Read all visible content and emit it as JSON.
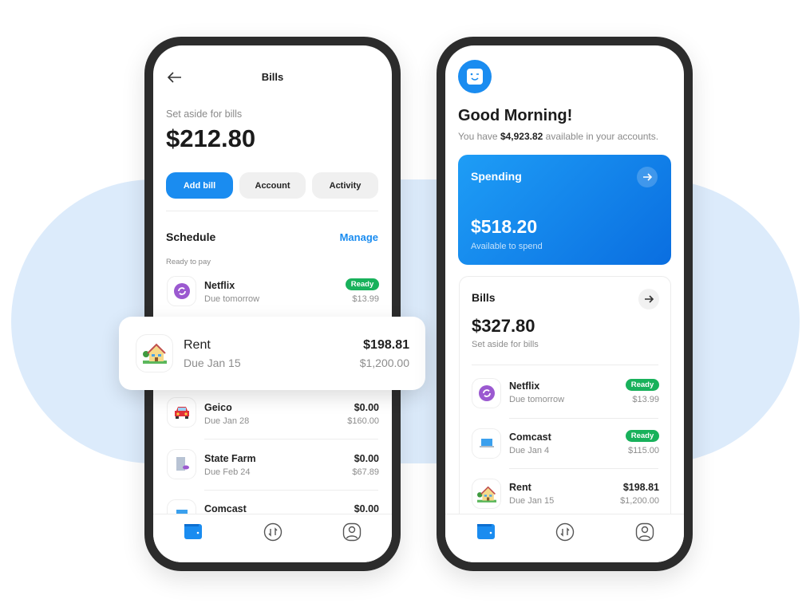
{
  "colors": {
    "accent": "#1a8cf0",
    "ready": "#18b15b",
    "background_blob": "#dcebfb"
  },
  "left_phone": {
    "header": {
      "back_icon": "arrow-left-icon",
      "title": "Bills"
    },
    "summary": {
      "label": "Set aside for bills",
      "amount": "$212.80"
    },
    "buttons": {
      "add_bill": "Add bill",
      "account": "Account",
      "activity": "Activity"
    },
    "schedule": {
      "title": "Schedule",
      "manage": "Manage",
      "section_label": "Ready to pay"
    },
    "bills": [
      {
        "name": "Netflix",
        "due": "Due tomorrow",
        "badge": "Ready",
        "amount": "$13.99",
        "icon": "refresh-icon"
      },
      {
        "name": "Rent",
        "due": "Due Jan 15",
        "amount": "$198.81",
        "total": "$1,200.00",
        "icon": "house-icon"
      },
      {
        "name": "Geico",
        "due": "Due Jan 28",
        "amount": "$0.00",
        "total": "$160.00",
        "icon": "car-icon"
      },
      {
        "name": "State Farm",
        "due": "Due Feb 24",
        "amount": "$0.00",
        "total": "$67.89",
        "icon": "document-icon"
      },
      {
        "name": "Comcast",
        "amount": "$0.00",
        "icon": "laptop-icon"
      }
    ],
    "nav": [
      "wallet-icon",
      "transfer-icon",
      "profile-icon"
    ]
  },
  "right_phone": {
    "greeting": "Good Morning!",
    "subtitle_prefix": "You have ",
    "subtitle_amount": "$4,923.82",
    "subtitle_suffix": " available in your accounts.",
    "spending": {
      "title": "Spending",
      "amount": "$518.20",
      "label": "Available to spend"
    },
    "bills_card": {
      "title": "Bills",
      "amount": "$327.80",
      "label": "Set aside for bills"
    },
    "bills": [
      {
        "name": "Netflix",
        "due": "Due tomorrow",
        "badge": "Ready",
        "amount": "$13.99"
      },
      {
        "name": "Comcast",
        "due": "Due Jan 4",
        "badge": "Ready",
        "amount": "$115.00"
      },
      {
        "name": "Rent",
        "due": "Due Jan 15",
        "amount": "$198.81",
        "total": "$1,200.00"
      }
    ],
    "nav": [
      "wallet-icon",
      "transfer-icon",
      "profile-icon"
    ]
  }
}
